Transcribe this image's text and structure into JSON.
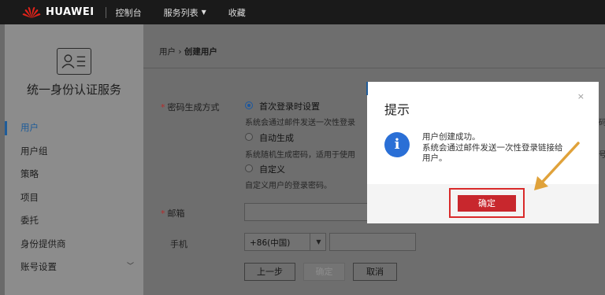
{
  "topbar": {
    "brand": "HUAWEI",
    "nav": [
      "控制台",
      "服务列表",
      "收藏"
    ]
  },
  "sidebar": {
    "title": "统一身份认证服务",
    "items": [
      {
        "label": "用户"
      },
      {
        "label": "用户组"
      },
      {
        "label": "策略"
      },
      {
        "label": "项目"
      },
      {
        "label": "委托"
      },
      {
        "label": "身份提供商"
      },
      {
        "label": "账号设置"
      }
    ]
  },
  "breadcrumb": {
    "parent": "用户",
    "sep": "›",
    "current": "创建用户"
  },
  "form": {
    "password_label": "密码生成方式",
    "options": [
      {
        "label": "首次登录时设置",
        "hint": "系统会通过邮件发送一次性登录"
      },
      {
        "label": "自动生成",
        "hint": "系统随机生成密码，适用于使用"
      },
      {
        "label": "自定义",
        "hint": "自定义用户的登录密码。"
      }
    ],
    "email_label": "邮箱",
    "phone_label": "手机",
    "phone_prefix": "+86(中国)",
    "buttons": {
      "prev": "上一步",
      "confirm": "确定",
      "cancel": "取消"
    },
    "cut_hint_1": "码",
    "cut_hint_2": "号"
  },
  "dialog": {
    "title": "提示",
    "close": "×",
    "icon": "i",
    "message_line1": "用户创建成功。",
    "message_line2": "系统会通过邮件发送一次性登录链接给",
    "message_line3": "用户。",
    "confirm": "确定"
  },
  "colors": {
    "accent": "#2a6fd6",
    "danger": "#c8272d",
    "highlight": "#d92a2a",
    "arrow": "#e0a23a"
  },
  "icons": {
    "logo": "huawei-logo-icon",
    "sidebar": "user-card-icon",
    "info": "info-icon",
    "arrow": "pointer-arrow-icon"
  }
}
